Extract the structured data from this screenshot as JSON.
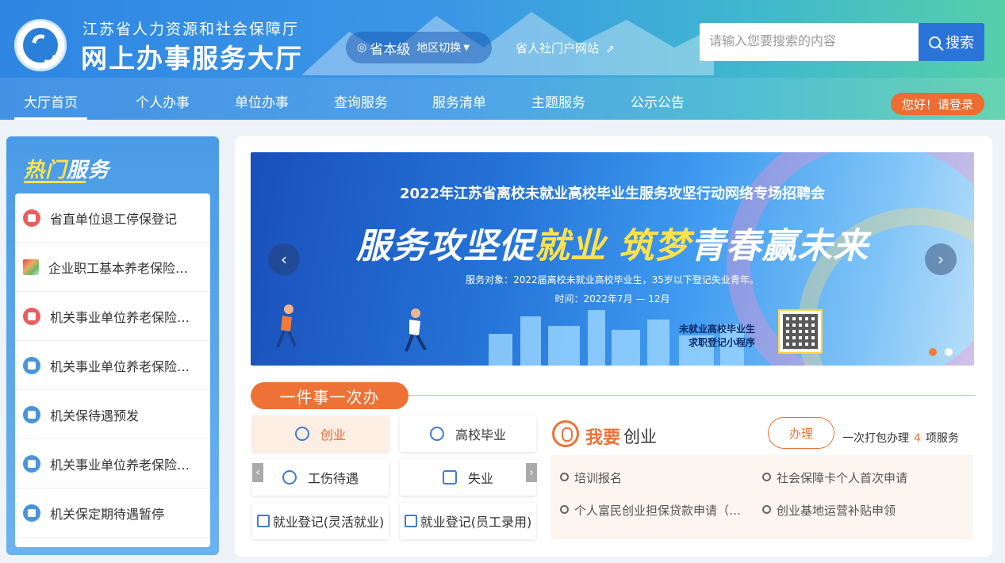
{
  "header": {
    "org_name": "江苏省人力资源和社会保障厅",
    "hall_name": "网上办事服务大厅",
    "region_level": "省本级",
    "region_switch": "地区切换",
    "portal_link": "省人社门户网站",
    "search_placeholder": "请输入您要搜索的内容",
    "search_button": "搜索",
    "login_label": "您好！请登录"
  },
  "nav": [
    {
      "label": "大厅首页",
      "active": true
    },
    {
      "label": "个人办事"
    },
    {
      "label": "单位办事"
    },
    {
      "label": "查询服务"
    },
    {
      "label": "服务清单"
    },
    {
      "label": "主题服务"
    },
    {
      "label": "公示公告"
    }
  ],
  "hot": {
    "title_a": "热门",
    "title_b": "服务",
    "items": [
      {
        "label": "省直单位退工停保登记",
        "icon": "red"
      },
      {
        "label": "企业职工基本养老保险…",
        "icon": "img"
      },
      {
        "label": "机关事业单位养老保险…",
        "icon": "red"
      },
      {
        "label": "机关事业单位养老保险…",
        "icon": "blue"
      },
      {
        "label": "机关保待遇预发",
        "icon": "blue"
      },
      {
        "label": "机关事业单位养老保险…",
        "icon": "blue"
      },
      {
        "label": "机关保定期待遇暂停",
        "icon": "blue"
      }
    ]
  },
  "banner": {
    "top_title": "2022年江苏省离校未就业高校毕业生服务攻坚行动网络专场招聘会",
    "slogan_a": "服务攻坚促",
    "slogan_b": "就业",
    "slogan_c": " ",
    "slogan_d": "筑梦",
    "slogan_e": "青春赢未来",
    "target": "服务对象：2022届离校未就业高校毕业生，35岁以下登记失业青年。",
    "time": "时间：2022年7月 — 12月",
    "qr_line1": "未就业高校毕业生",
    "qr_line2": "求职登记小程序",
    "prev": "‹",
    "next": "›"
  },
  "yjs": {
    "title": "一件事一次办",
    "categories": [
      {
        "label": "创业",
        "active": true
      },
      {
        "label": "高校毕业"
      },
      {
        "label": "工伤待遇"
      },
      {
        "label": "失业"
      },
      {
        "label": "就业登记(灵活就业)"
      },
      {
        "label": "就业登记(员工录用)"
      }
    ],
    "arrow_left": "‹",
    "arrow_right": "›",
    "detail": {
      "title_a": "我要",
      "title_b": "创业",
      "do_label": "办理",
      "pack_prefix": "一次打包办理",
      "pack_count": "4",
      "pack_suffix": "项服务",
      "links": [
        "培训报名",
        "社会保障卡个人首次申请",
        "个人富民创业担保贷款申请（…",
        "创业基地运营补贴申领"
      ]
    }
  }
}
